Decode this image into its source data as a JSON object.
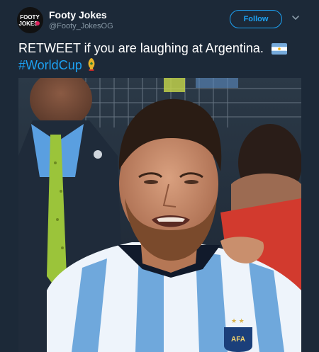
{
  "account": {
    "display_name": "Footy Jokes",
    "handle": "@Footy_JokesOG",
    "avatar_logo_text": [
      "FOOTY",
      "JOKES"
    ],
    "follow_label": "Follow"
  },
  "tweet": {
    "text": "RETWEET if you are laughing at Argentina.",
    "hashtag": "#WorldCup",
    "flag_emoji": "argentina-flag",
    "trophy_emoji": "world-cup-trophy"
  },
  "media": {
    "description_icon": "photo",
    "jersey_badge_text": "AFA"
  },
  "colors": {
    "background": "#1c2938",
    "accent": "#1da1f2",
    "secondary_text": "#8899a6"
  }
}
